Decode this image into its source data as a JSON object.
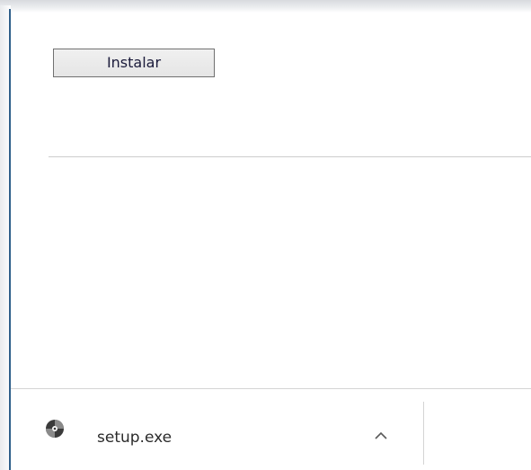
{
  "page": {
    "install_button_label": "Instalar"
  },
  "download_bar": {
    "items": [
      {
        "file_name": "setup.exe",
        "icon": "installer-disc-icon",
        "expand_icon": "chevron-up-icon"
      }
    ]
  }
}
